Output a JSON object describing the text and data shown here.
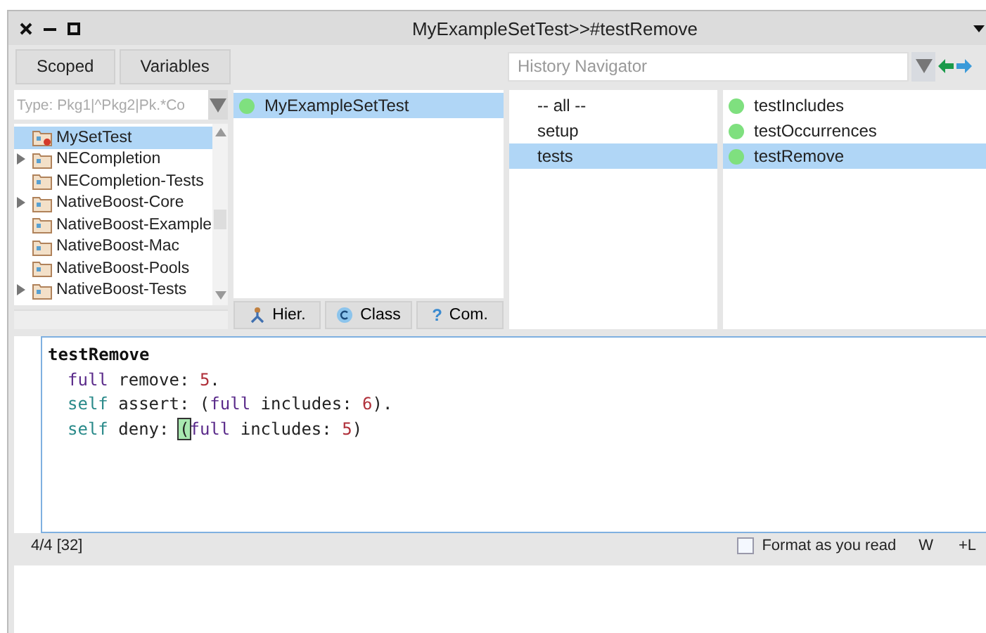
{
  "window": {
    "title": "MyExampleSetTest>>#testRemove"
  },
  "toolbar": {
    "buttons": [
      "Scoped",
      "Variables"
    ],
    "history": {
      "placeholder": "History Navigator"
    }
  },
  "packages": {
    "filter": {
      "placeholder": "Type: Pkg1|^Pkg2|Pk.*Co"
    },
    "items": [
      {
        "label": "MySetTest",
        "kind": "test",
        "expandable": false,
        "selected": true
      },
      {
        "label": "NECompletion",
        "kind": "plain",
        "expandable": true,
        "selected": false
      },
      {
        "label": "NECompletion-Tests",
        "kind": "plain",
        "expandable": false,
        "selected": false
      },
      {
        "label": "NativeBoost-Core",
        "kind": "plain",
        "expandable": true,
        "selected": false
      },
      {
        "label": "NativeBoost-Example",
        "kind": "plain",
        "expandable": false,
        "selected": false
      },
      {
        "label": "NativeBoost-Mac",
        "kind": "plain",
        "expandable": false,
        "selected": false
      },
      {
        "label": "NativeBoost-Pools",
        "kind": "plain",
        "expandable": false,
        "selected": false
      },
      {
        "label": "NativeBoost-Tests",
        "kind": "plain",
        "expandable": true,
        "selected": false
      }
    ]
  },
  "classes": {
    "items": [
      {
        "label": "MyExampleSetTest",
        "color": "#7fe07f",
        "selected": true
      }
    ],
    "modes": [
      {
        "label": "Hier.",
        "kind": "hierarchy"
      },
      {
        "label": "Class",
        "kind": "class"
      },
      {
        "label": "Com.",
        "kind": "comment",
        "glyph": "?"
      }
    ]
  },
  "protocols": {
    "items": [
      {
        "label": "-- all --",
        "selected": false
      },
      {
        "label": "setup",
        "selected": false
      },
      {
        "label": "tests",
        "selected": true
      }
    ]
  },
  "methods": {
    "items": [
      {
        "label": "testIncludes",
        "color": "#7fe07f",
        "selected": false
      },
      {
        "label": "testOccurrences",
        "color": "#7fe07f",
        "selected": false
      },
      {
        "label": "testRemove",
        "color": "#7fe07f",
        "selected": true
      }
    ]
  },
  "editor": {
    "lines": [
      {
        "indent": false,
        "tokens": [
          {
            "text": "testRemove",
            "kind": "selector"
          }
        ]
      },
      {
        "indent": true,
        "tokens": [
          {
            "text": "full",
            "kind": "var"
          },
          {
            "text": " remove: "
          },
          {
            "text": "5",
            "kind": "number"
          },
          {
            "text": "."
          }
        ]
      },
      {
        "indent": true,
        "tokens": [
          {
            "text": "self",
            "kind": "self"
          },
          {
            "text": " assert: ("
          },
          {
            "text": "full",
            "kind": "var"
          },
          {
            "text": " includes: "
          },
          {
            "text": "6",
            "kind": "number"
          },
          {
            "text": ")."
          }
        ]
      },
      {
        "indent": true,
        "tokens": [
          {
            "text": "self",
            "kind": "self"
          },
          {
            "text": " deny: "
          },
          {
            "text": "(",
            "kind": "match"
          },
          {
            "text": "full",
            "kind": "var"
          },
          {
            "text": " includes: "
          },
          {
            "text": "5",
            "kind": "number"
          },
          {
            "text": ")"
          }
        ]
      }
    ]
  },
  "status_bar": {
    "position": "4/4 [32]",
    "format": {
      "label": "Format as you read",
      "checked": false
    },
    "wrap": "W",
    "line_numbers": "+L"
  }
}
